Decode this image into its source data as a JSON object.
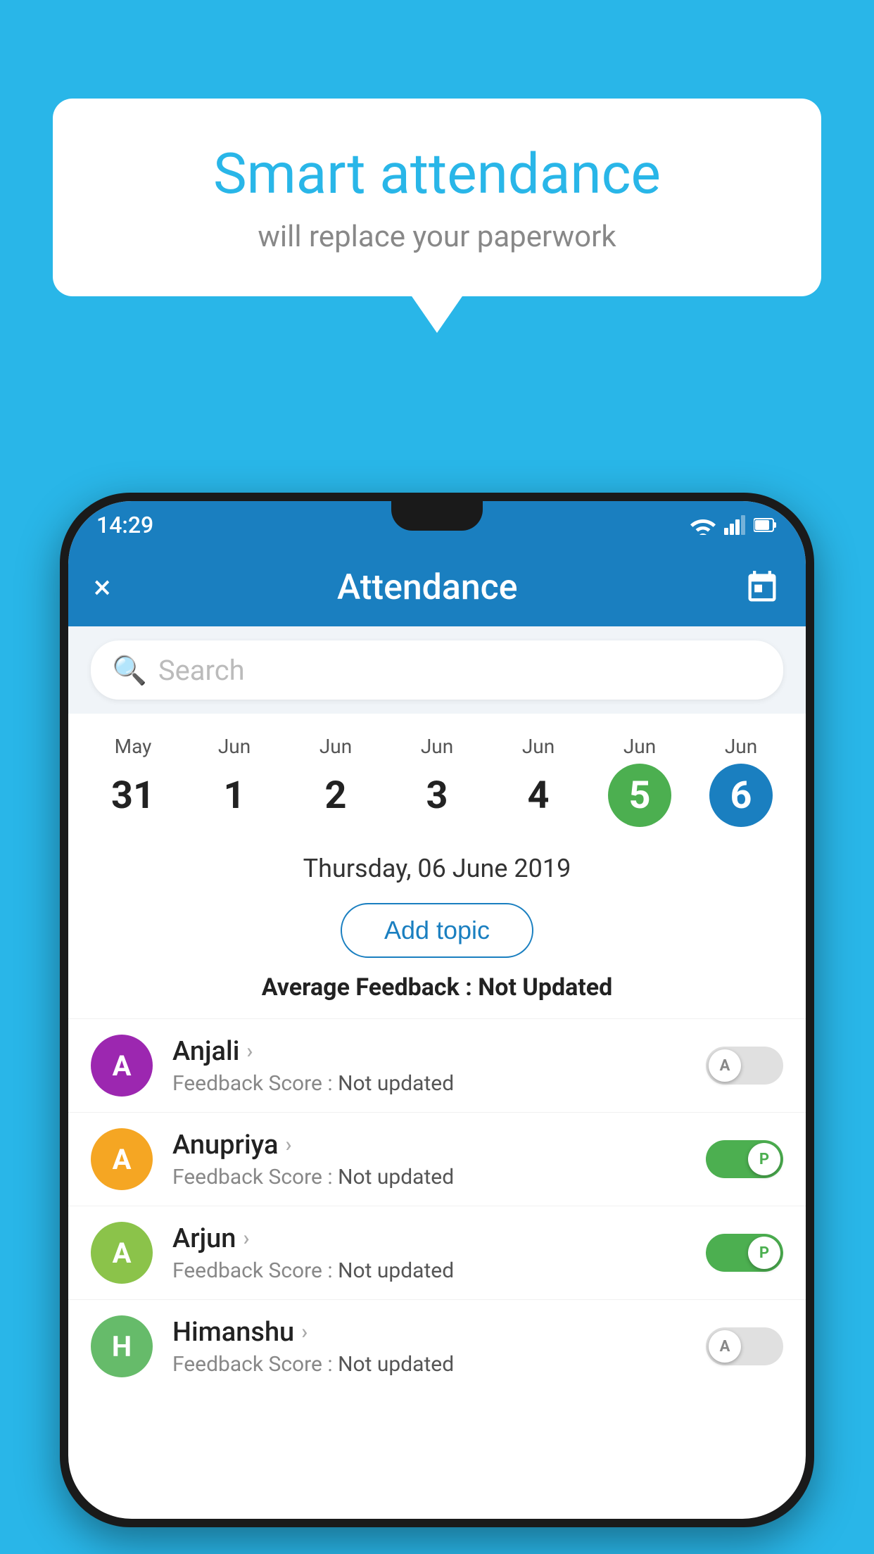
{
  "background_color": "#29b6e8",
  "bubble": {
    "title": "Smart attendance",
    "subtitle": "will replace your paperwork"
  },
  "status_bar": {
    "time": "14:29"
  },
  "app_bar": {
    "title": "Attendance",
    "close_label": "×"
  },
  "search": {
    "placeholder": "Search"
  },
  "calendar": {
    "cols": [
      {
        "month": "May",
        "day": "31",
        "style": "normal"
      },
      {
        "month": "Jun",
        "day": "1",
        "style": "normal"
      },
      {
        "month": "Jun",
        "day": "2",
        "style": "normal"
      },
      {
        "month": "Jun",
        "day": "3",
        "style": "normal"
      },
      {
        "month": "Jun",
        "day": "4",
        "style": "normal"
      },
      {
        "month": "Jun",
        "day": "5",
        "style": "green"
      },
      {
        "month": "Jun",
        "day": "6",
        "style": "blue"
      }
    ]
  },
  "selected_date": "Thursday, 06 June 2019",
  "add_topic_label": "Add topic",
  "avg_feedback_label": "Average Feedback : ",
  "avg_feedback_value": "Not Updated",
  "students": [
    {
      "name": "Anjali",
      "avatar_letter": "A",
      "avatar_class": "purple",
      "feedback": "Feedback Score : ",
      "feedback_value": "Not updated",
      "toggle_state": "off",
      "toggle_letter": "A"
    },
    {
      "name": "Anupriya",
      "avatar_letter": "A",
      "avatar_class": "yellow",
      "feedback": "Feedback Score : ",
      "feedback_value": "Not updated",
      "toggle_state": "on",
      "toggle_letter": "P"
    },
    {
      "name": "Arjun",
      "avatar_letter": "A",
      "avatar_class": "light-green",
      "feedback": "Feedback Score : ",
      "feedback_value": "Not updated",
      "toggle_state": "on",
      "toggle_letter": "P"
    },
    {
      "name": "Himanshu",
      "avatar_letter": "H",
      "avatar_class": "teal-green",
      "feedback": "Feedback Score : ",
      "feedback_value": "Not updated",
      "toggle_state": "off",
      "toggle_letter": "A"
    }
  ]
}
